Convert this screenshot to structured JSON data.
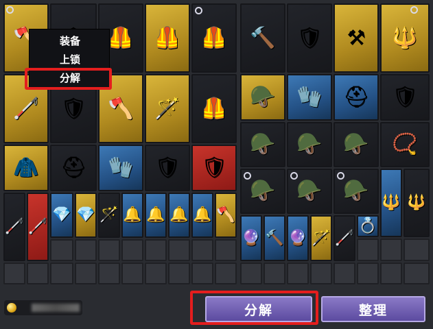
{
  "context_menu": {
    "items": [
      {
        "label": "装备"
      },
      {
        "label": "上锁"
      },
      {
        "label": "分解"
      }
    ]
  },
  "footer": {
    "disassemble_label": "分解",
    "sort_label": "整理"
  },
  "colors": {
    "highlight": "#e41e1e",
    "button": "#6a58ad",
    "rarity_gold": "#c9a42c",
    "rarity_blue": "#2f659f",
    "rarity_red": "#b22a22",
    "rarity_black": "#1d1e23"
  },
  "inventory_icons": {
    "row1": [
      "axe-icon",
      "shoulder-armor-icon",
      "gauntlet-armor-icon",
      "chest-armor-icon",
      "chest-armor-icon",
      "mace-icon",
      "shield-icon",
      "flail-icon",
      "spear-icon"
    ],
    "row2": [
      "staff-icon",
      "chest-armor-icon",
      "battle-axe-icon",
      "magic-staff-icon",
      "leather-vest-icon",
      "antler-helmet-icon",
      "gloves-icon",
      "helmet-icon",
      "round-shield-icon"
    ],
    "row3": [
      "hood-icon",
      "helmet-icon",
      "gloves-icon",
      "round-shield-icon",
      "round-shield-icon",
      "helmet-icon",
      "helmet-icon",
      "helmet-icon",
      "necklace-icon"
    ],
    "row4": [
      "helmet-icon",
      "helmet-icon",
      "helmet-icon",
      "trident-icon",
      "trident-icon"
    ],
    "row5": [
      "staff-icon",
      "staff-icon",
      "earring-icon",
      "earring-icon",
      "wand-icon",
      "earring-icon",
      "earring-icon",
      "earring-icon",
      "earring-icon",
      "axe-icon"
    ],
    "row6": [
      "amulet-icon",
      "mace-icon",
      "amulet-icon",
      "wand-icon",
      "staff-icon",
      "ring-icon"
    ]
  }
}
